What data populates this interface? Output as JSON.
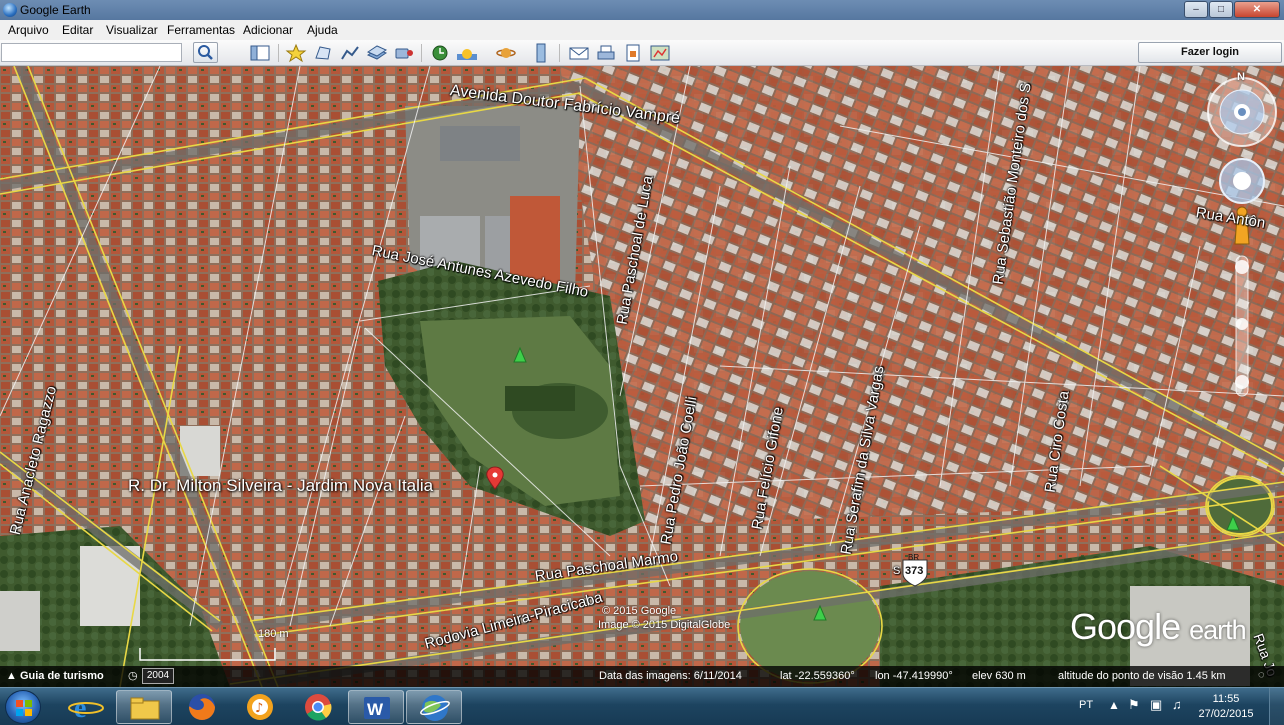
{
  "window": {
    "title": "Google Earth",
    "minimize": "–",
    "maximize": "□",
    "close": "✕"
  },
  "menu": [
    "Arquivo",
    "Editar",
    "Visualizar",
    "Ferramentas",
    "Adicionar",
    "Ajuda"
  ],
  "search": {
    "value": "",
    "placeholder": ""
  },
  "toolbar": {
    "login_label": "Fazer login",
    "icons": [
      "sidebar-icon",
      "placemark-icon",
      "polygon-icon",
      "path-icon",
      "image-overlay-icon",
      "record-tour-icon",
      "historical-imagery-icon",
      "sun-icon",
      "planets-icon",
      "ruler-icon",
      "email-icon",
      "print-icon",
      "save-image-icon",
      "view-in-maps-icon"
    ]
  },
  "map": {
    "streets": [
      "Avenida Doutor Fabrício Vampré",
      "Rua José Antunes Azevedo Filho",
      "Rua Paschoal de Luca",
      "Rua Sebastião Monteiro dos S",
      "Rua Antôn",
      "Rua Anacleto Ragazzo",
      "Rua Pedro João Coelli",
      "Rua Felício Gifone",
      "Rua Serafim da Silva Vargas",
      "Rua Ciro Costa",
      "Rua Paschoal Marmo",
      "Rodovia Limeira-Piracicaba",
      "Rua Jo"
    ],
    "placemark_label": "R. Dr. Milton Silveira - Jardim Nova Italia",
    "highway_shield": {
      "top": "BR",
      "number": "373",
      "prefix": "S"
    },
    "copyright_line1": "© 2015 Google",
    "copyright_line2": "Image © 2015 DigitalGlobe",
    "watermark_a": "Google",
    "watermark_b": "earth",
    "scale": "180 m",
    "compass_north": "N"
  },
  "status": {
    "tour_label": "Guia de turismo",
    "history_year": "2004",
    "image_date": "Data das imagens: 6/11/2014",
    "lat": "lat  -22.559360°",
    "lon": "lon  -47.419990°",
    "elev": "elev   630 m",
    "eye_alt": "altitude do ponto de visão   1.45 km"
  },
  "taskbar": {
    "language": "PT",
    "time": "11:55",
    "date": "27/02/2015",
    "apps": [
      "internet-explorer-icon",
      "file-explorer-icon",
      "firefox-icon",
      "itunes-icon",
      "chrome-icon",
      "word-icon",
      "google-earth-icon"
    ]
  },
  "colors": {
    "titlebar": "#5f80a8",
    "road_yellow": "#e8d845",
    "road_white": "#f2f2f2",
    "park_green": "#4f6b3a",
    "roof": "#b4583c",
    "taskbar": "#1d4460"
  }
}
